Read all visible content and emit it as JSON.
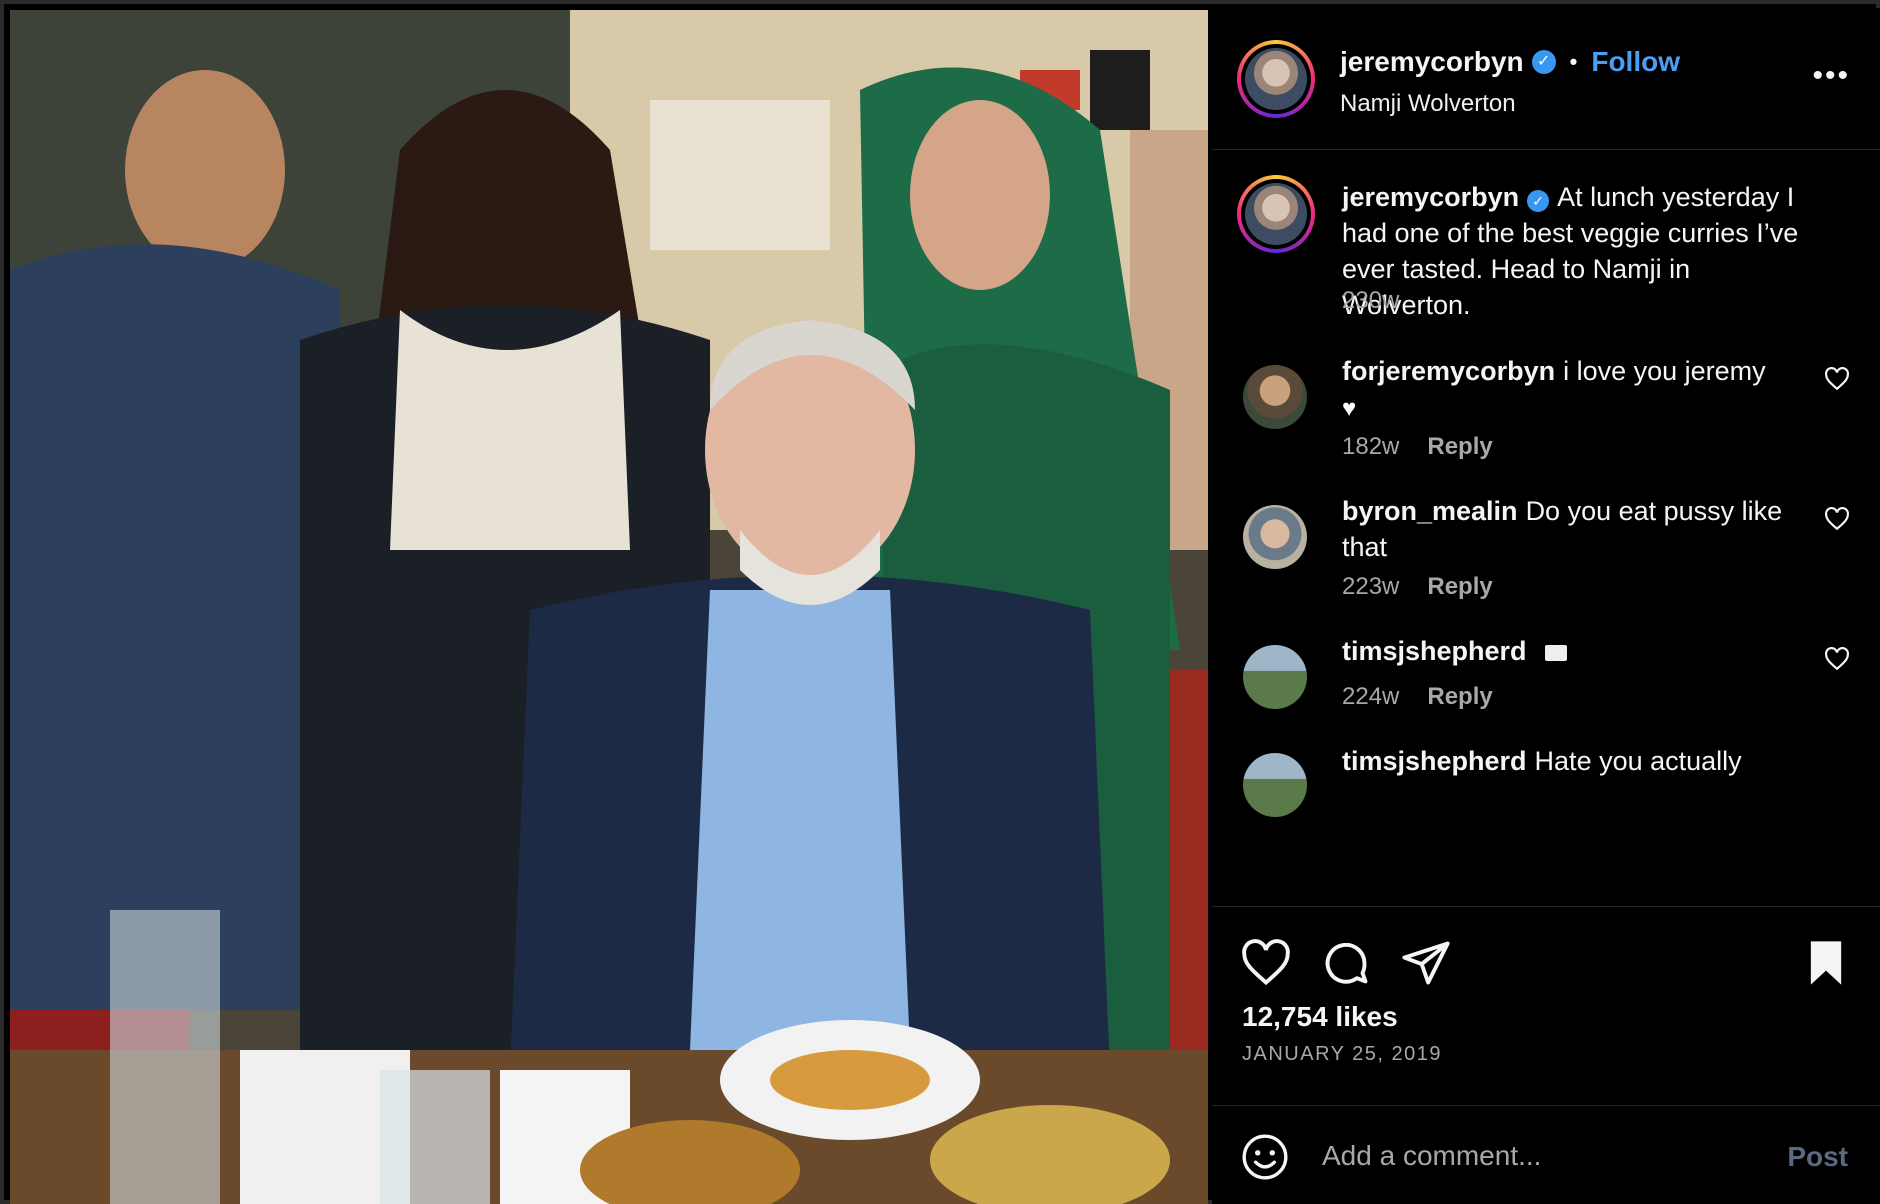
{
  "post": {
    "username": "jeremycorbyn",
    "follow_label": "Follow",
    "location": "Namji Wolverton",
    "more_label": "•••",
    "caption": "At lunch yesterday I had one of the best veggie curries I’ve ever tasted. Head to Namji in Wolverton.",
    "caption_time": "230w"
  },
  "comments": [
    {
      "username": "forjeremycorbyn",
      "text": "i love you jeremy",
      "emoji": "♥",
      "time": "182w",
      "reply_label": "Reply"
    },
    {
      "username": "byron_mealin",
      "text": "Do you eat pussy like that",
      "time": "223w",
      "reply_label": "Reply"
    },
    {
      "username": "timsjshepherd",
      "text": "",
      "time": "224w",
      "reply_label": "Reply"
    },
    {
      "username": "timsjshepherd",
      "text": "Hate you actually"
    }
  ],
  "footer": {
    "likes": "12,754 likes",
    "date": "JANUARY 25, 2019",
    "comment_placeholder": "Add a comment...",
    "post_label": "Post"
  },
  "colors": {
    "accent": "#4a9ff5",
    "verified": "#3897f0",
    "muted": "#a8a8a8",
    "background": "#000000"
  },
  "icons": [
    "verified-icon",
    "more-icon",
    "heart-icon",
    "comment-icon",
    "share-icon",
    "bookmark-icon",
    "emoji-icon"
  ]
}
